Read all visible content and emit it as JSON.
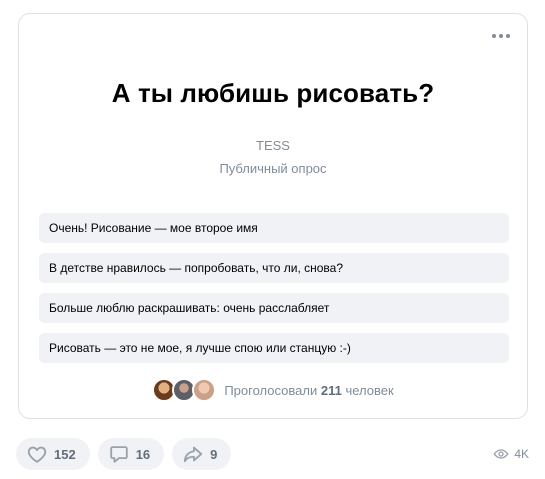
{
  "poll": {
    "title": "А ты любишь рисовать?",
    "author": "TESS",
    "type": "Публичный опрос",
    "options": [
      "Очень! Рисование — мое второе имя",
      "В детстве нравилось — попробовать, что ли, снова?",
      "Больше люблю раскрашивать: очень расслабляет",
      "Рисовать — это не мое, я лучше спою или станцую :-)"
    ],
    "voters_prefix": "Проголосовали",
    "voters_count": "211",
    "voters_suffix": "человек"
  },
  "actions": {
    "likes": "152",
    "comments": "16",
    "shares": "9",
    "views": "4K"
  },
  "icons": {
    "more": "more-dots-icon",
    "like": "heart-icon",
    "comment": "comment-icon",
    "share": "share-arrow-icon",
    "views": "eye-icon"
  },
  "colors": {
    "secondary_text": "#818c99",
    "option_bg": "#f0f2f5",
    "icon": "#99a2ad"
  }
}
